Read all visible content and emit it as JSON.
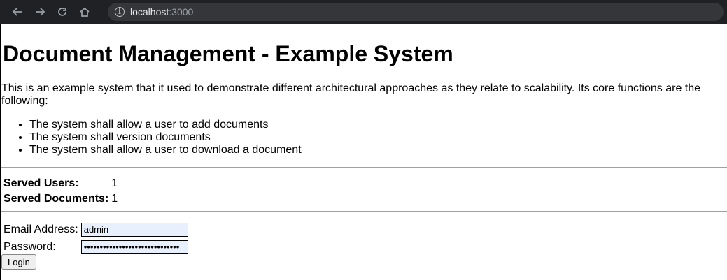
{
  "browser": {
    "url_host": "localhost",
    "url_port": ":3000",
    "nav_icons": [
      "back-icon",
      "forward-icon",
      "reload-icon",
      "home-icon",
      "info-icon"
    ]
  },
  "page": {
    "title": "Document Management - Example System",
    "intro": "This is an example system that it used to demonstrate different architectural approaches as they relate to scalability. Its core functions are the following:",
    "functions": [
      "The system shall allow a user to add documents",
      "The system shall version documents",
      "The system shall allow a user to download a document"
    ],
    "stats": {
      "served_users_label": "Served Users:",
      "served_users_value": "1",
      "served_documents_label": "Served Documents:",
      "served_documents_value": "1"
    },
    "login": {
      "email_label": "Email Address:",
      "email_value": "admin",
      "password_label": "Password:",
      "password_value": "••••••••••••••••••••••••••••••",
      "button_label": "Login"
    }
  }
}
